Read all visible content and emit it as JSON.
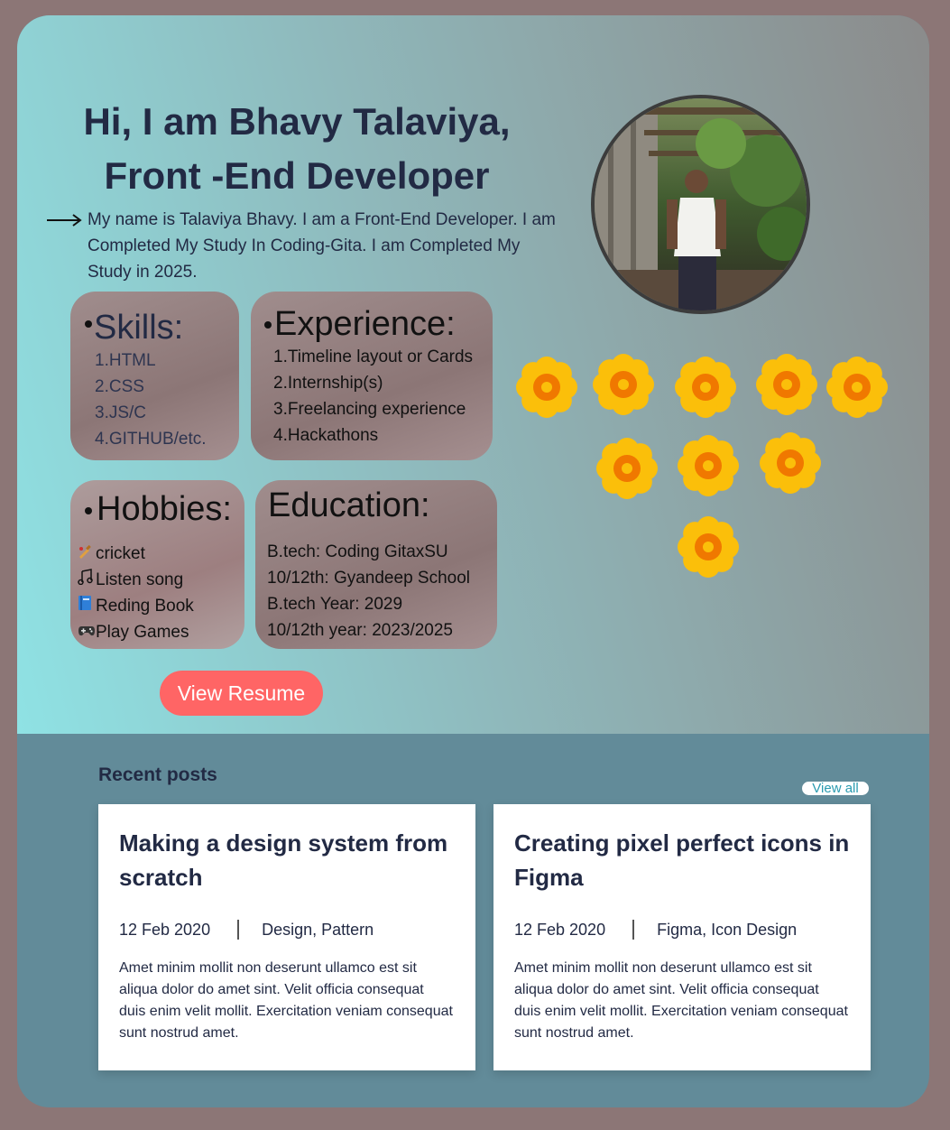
{
  "hero": {
    "title_line1": "Hi, I am Bhavy Talaviya,",
    "title_line2": "Front -End Developer",
    "intro": "My name is Talaviya Bhavy. I am a Front-End Developer. I am Completed My Study In Coding-Gita. I am Completed My Study in 2025.",
    "resume_button": "View Resume"
  },
  "skills": {
    "title": "Skills:",
    "items": [
      "1.HTML",
      "2.CSS",
      "3.JS/C",
      "4.GITHUB/etc."
    ]
  },
  "experience": {
    "title": "Experience:",
    "items": [
      "1.Timeline layout or Cards",
      "2.Internship(s)",
      "3.Freelancing experience",
      "4.Hackathons"
    ]
  },
  "hobbies": {
    "title": "Hobbies:",
    "items": [
      {
        "icon": "cricket-bat-icon",
        "label": "cricket"
      },
      {
        "icon": "music-note-icon",
        "label": "Listen song"
      },
      {
        "icon": "book-icon",
        "label": "Reding Book"
      },
      {
        "icon": "game-controller-icon",
        "label": "Play Games"
      }
    ]
  },
  "education": {
    "title": "Education:",
    "items": [
      "B.tech: Coding GitaxSU",
      "10/12th: Gyandeep School",
      "B.tech Year: 2029",
      "10/12th year: 2023/2025"
    ]
  },
  "recent_posts": {
    "title": "Recent posts",
    "view_all": "View all",
    "posts": [
      {
        "title": "Making a design system from scratch",
        "date": "12 Feb 2020",
        "tags": "Design, Pattern",
        "excerpt": "Amet minim mollit non deserunt ullamco est sit aliqua dolor do amet sint. Velit officia consequat duis enim velit mollit. Exercitation veniam consequat sunt nostrud amet."
      },
      {
        "title": "Creating pixel perfect icons in Figma",
        "date": "12 Feb 2020",
        "tags": "Figma, Icon Design",
        "excerpt": "Amet minim mollit non deserunt ullamco est sit aliqua dolor do amet sint. Velit officia consequat duis enim velit mollit. Exercitation veniam consequat sunt nostrud amet."
      }
    ]
  },
  "colors": {
    "accent_button": "#ff6565",
    "text_dark": "#222a44",
    "posts_background": "#628b99",
    "flower_petal": "#fbbf0a",
    "flower_center": "#f07800"
  }
}
